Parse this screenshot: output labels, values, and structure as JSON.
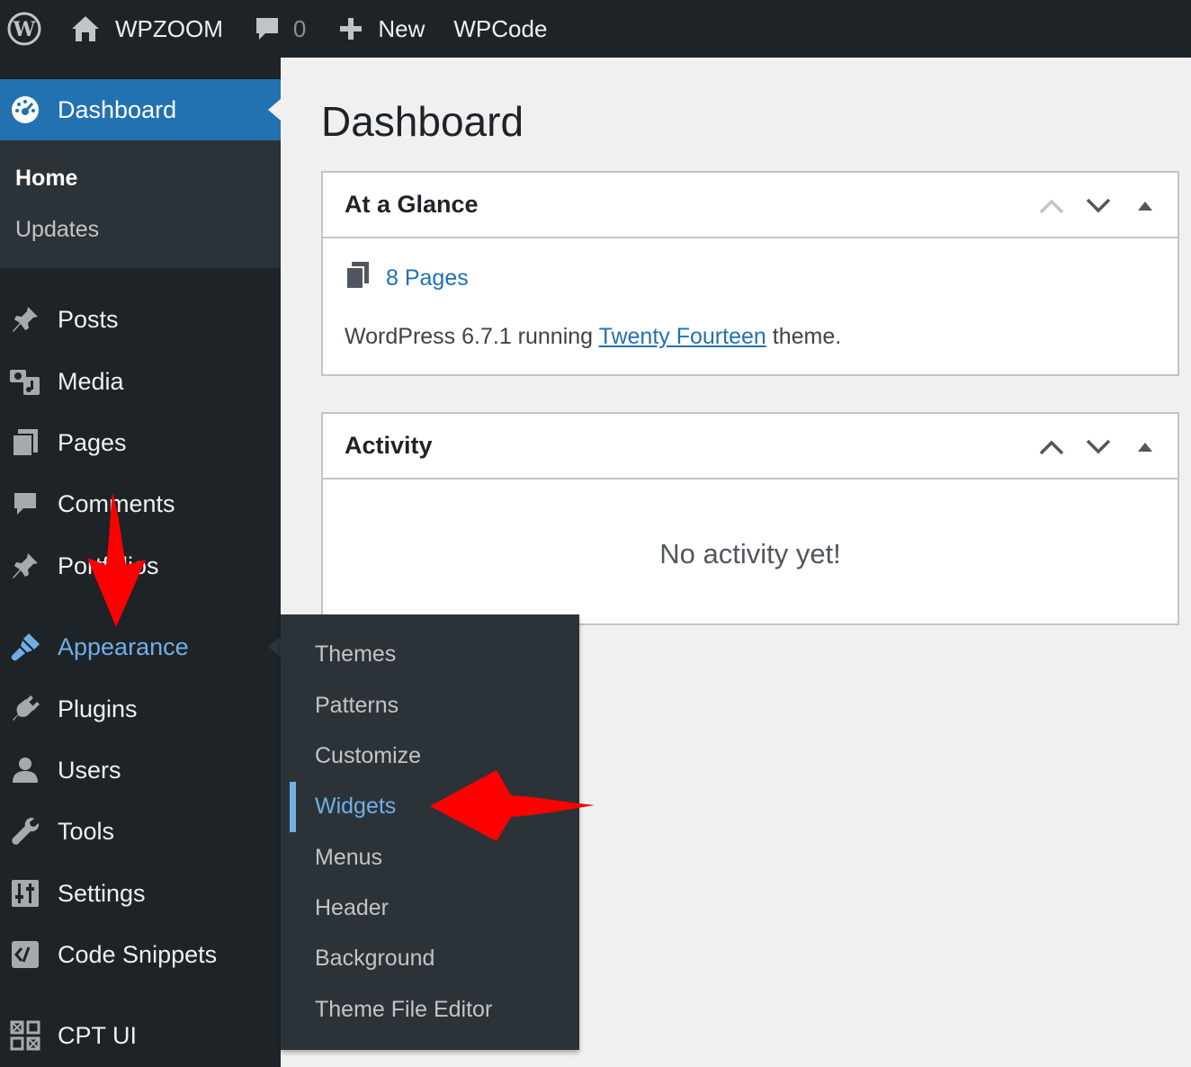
{
  "adminbar": {
    "site_name": "WPZOOM",
    "comments_count": "0",
    "new_label": "New",
    "wpcode_label": "WPCode"
  },
  "sidebar": {
    "dashboard": {
      "label": "Dashboard",
      "icon": "dashboard-gauge-icon",
      "submenu": [
        "Home",
        "Updates"
      ]
    },
    "items": [
      {
        "label": "Posts",
        "icon": "pushpin-icon"
      },
      {
        "label": "Media",
        "icon": "media-icon"
      },
      {
        "label": "Pages",
        "icon": "pages-icon"
      },
      {
        "label": "Comments",
        "icon": "comment-bubble-icon"
      },
      {
        "label": "Portfolios",
        "icon": "pushpin-icon"
      },
      {
        "label": "Appearance",
        "icon": "paintbrush-icon"
      },
      {
        "label": "Plugins",
        "icon": "plugin-icon"
      },
      {
        "label": "Users",
        "icon": "user-icon"
      },
      {
        "label": "Tools",
        "icon": "wrench-icon"
      },
      {
        "label": "Settings",
        "icon": "settings-sliders-icon"
      },
      {
        "label": "Code Snippets",
        "icon": "code-icon"
      },
      {
        "label": "CPT UI",
        "icon": "grid-icon"
      }
    ]
  },
  "flyout": {
    "items": [
      "Themes",
      "Patterns",
      "Customize",
      "Widgets",
      "Menus",
      "Header",
      "Background",
      "Theme File Editor"
    ]
  },
  "main": {
    "title": "Dashboard",
    "glance": {
      "title": "At a Glance",
      "pages": "8 Pages",
      "ver_prefix": "WordPress 6.7.1 running ",
      "theme_link": "Twenty Fourteen",
      "ver_suffix": " theme."
    },
    "activity": {
      "title": "Activity",
      "empty": "No activity yet!"
    }
  },
  "colors": {
    "adminbar_bg": "#1d2327",
    "accent_blue": "#2271b1",
    "active_link": "#72aee6",
    "annotation_red": "#ff0000"
  }
}
